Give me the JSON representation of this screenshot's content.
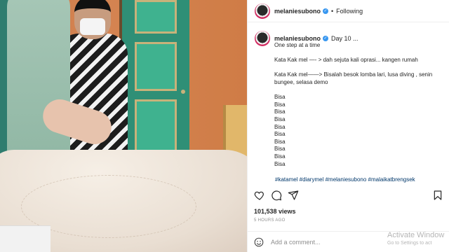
{
  "post": {
    "username": "melaniesubono",
    "follow_status": "Following",
    "caption_title": "Day 10 ...",
    "caption_lines": [
      "One step at a time",
      "",
      "Kata Kak mel —- > dah sejuta kali oprasi... kangen rumah",
      "",
      "Kata Kak mel——> Bisalah besok lomba lari, lusa diving , senin",
      "bungee, selasa demo",
      "",
      "Bisa",
      "Bisa",
      "Bisa",
      "Bisa",
      "Bisa",
      "Bisa",
      "Bisa",
      "Bisa",
      "Bisa",
      "Bisa"
    ],
    "hashtags": "#katamel #diarymel #melaniesubono #malaikatbrengsek",
    "views": "101,538 views",
    "time_ago": "5 HOURS AGO",
    "comment_placeholder": "Add a comment..."
  },
  "icons": {
    "verified": "verified-badge-icon",
    "like": "heart-icon",
    "comment": "comment-icon",
    "share": "share-icon",
    "save": "bookmark-icon",
    "emoji": "emoji-icon"
  },
  "watermark": {
    "line1": "Activate Window",
    "line2": "Go to Settings to act"
  },
  "colors": {
    "verified": "#3897f0",
    "link": "#00376b",
    "muted": "#8e8e8e"
  }
}
